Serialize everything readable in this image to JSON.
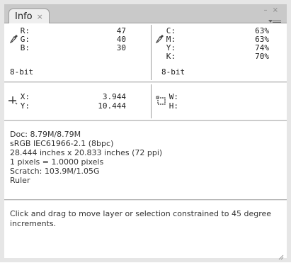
{
  "panel": {
    "tab_label": "Info",
    "tab_close": "×"
  },
  "rgb": {
    "rows": [
      {
        "label": "R:",
        "value": "47"
      },
      {
        "label": "G:",
        "value": "40"
      },
      {
        "label": "B:",
        "value": "30"
      }
    ],
    "bit_depth": "8-bit",
    "icon": "eyedropper-icon"
  },
  "cmyk": {
    "rows": [
      {
        "label": "C:",
        "value": "63%"
      },
      {
        "label": "M:",
        "value": "63%"
      },
      {
        "label": "Y:",
        "value": "74%"
      },
      {
        "label": "K:",
        "value": "70%"
      }
    ],
    "bit_depth": "8-bit",
    "icon": "eyedropper-icon"
  },
  "position": {
    "x_label": "X:",
    "x_value": "3.944",
    "y_label": "Y:",
    "y_value": "10.444",
    "icon": "crosshair-icon"
  },
  "size": {
    "w_label": "W:",
    "w_value": "",
    "h_label": "H:",
    "h_value": "",
    "icon": "selection-size-icon"
  },
  "document": {
    "lines": [
      "Doc: 8.79M/8.79M",
      "sRGB IEC61966-2.1 (8bpc)",
      "28.444 inches x 20.833 inches (72 ppi)",
      "1 pixels = 1.0000 pixels",
      "Scratch: 103.9M/1.05G",
      "Ruler"
    ]
  },
  "hint": {
    "text": "Click and drag to move layer or selection constrained to 45 degree increments."
  }
}
